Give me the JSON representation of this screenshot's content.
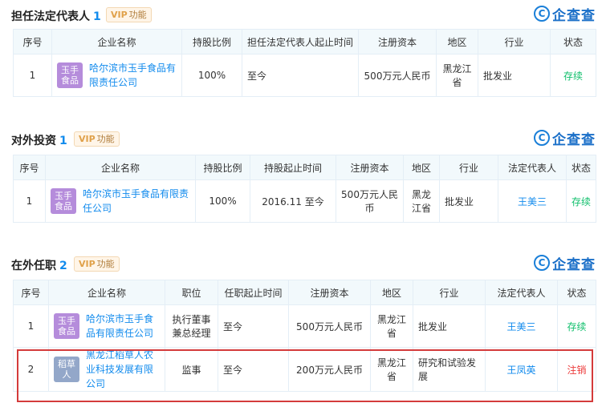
{
  "brand": {
    "name": "企查查",
    "logo_glyph": "C"
  },
  "colors": {
    "accent": "#128bed",
    "active": "#0fbf6b",
    "cancelled": "#ec3b3b",
    "highlight": "#d43b3b"
  },
  "sections": {
    "legal_rep": {
      "title": "担任法定代表人",
      "count": "1",
      "vip": {
        "prefix": "VIP",
        "label": "功能"
      },
      "columns": [
        "序号",
        "企业名称",
        "持股比例",
        "担任法定代表人起止时间",
        "注册资本",
        "地区",
        "行业",
        "状态"
      ],
      "rows": [
        {
          "no": "1",
          "logo": "玉手\n食品",
          "logo_color": "#b58cdb",
          "company": "哈尔滨市玉手食品有限责任公司",
          "ratio": "100%",
          "period": "至今",
          "capital": "500万元人民币",
          "region": "黑龙江省",
          "industry": "批发业",
          "status": "存续"
        }
      ]
    },
    "investment": {
      "title": "对外投资",
      "count": "1",
      "vip": {
        "prefix": "VIP",
        "label": "功能"
      },
      "columns": [
        "序号",
        "企业名称",
        "持股比例",
        "持股起止时间",
        "注册资本",
        "地区",
        "行业",
        "法定代表人",
        "状态"
      ],
      "rows": [
        {
          "no": "1",
          "logo": "玉手\n食品",
          "logo_color": "#b58cdb",
          "company": "哈尔滨市玉手食品有限责任公司",
          "ratio": "100%",
          "period": "2016.11 至今",
          "capital": "500万元人民币",
          "region": "黑龙江省",
          "industry": "批发业",
          "rep": "王美三",
          "status": "存续"
        }
      ]
    },
    "positions": {
      "title": "在外任职",
      "count": "2",
      "vip": {
        "prefix": "VIP",
        "label": "功能"
      },
      "columns": [
        "序号",
        "企业名称",
        "职位",
        "任职起止时间",
        "注册资本",
        "地区",
        "行业",
        "法定代表人",
        "状态"
      ],
      "rows": [
        {
          "no": "1",
          "logo": "玉手\n食品",
          "logo_color": "#b58cdb",
          "company": "哈尔滨市玉手食品有限责任公司",
          "position": "执行董事兼总经理",
          "period": "至今",
          "capital": "500万元人民币",
          "region": "黑龙江省",
          "industry": "批发业",
          "rep": "王美三",
          "status": "存续"
        },
        {
          "no": "2",
          "logo": "稻草\n人",
          "logo_color": "#93a7c9",
          "company": "黑龙江稻草人农业科技发展有限公司",
          "position": "监事",
          "period": "至今",
          "capital": "200万元人民币",
          "region": "黑龙江省",
          "industry": "研究和试验发展",
          "rep": "王凤英",
          "status": "注销"
        }
      ]
    }
  }
}
